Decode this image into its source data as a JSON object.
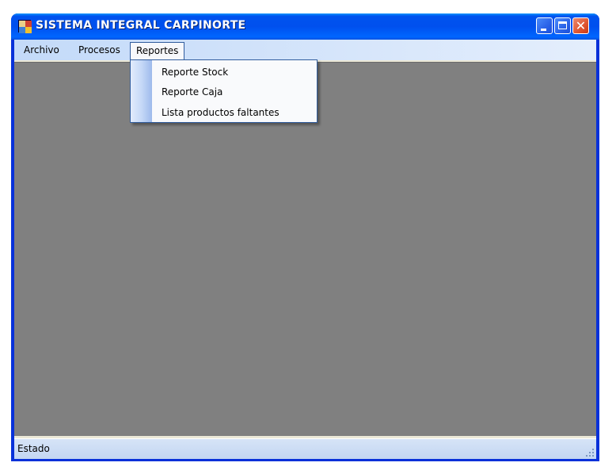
{
  "window": {
    "title": "SISTEMA INTEGRAL CARPINORTE",
    "close_glyph": "✕"
  },
  "menubar": {
    "items": [
      {
        "label": "Archivo"
      },
      {
        "label": "Procesos"
      },
      {
        "label": "Reportes",
        "open": true
      }
    ]
  },
  "dropdown": {
    "items": [
      {
        "label": "Reporte Stock"
      },
      {
        "label": "Reporte Caja"
      },
      {
        "label": "Lista productos faltantes"
      }
    ]
  },
  "statusbar": {
    "text": "Estado"
  },
  "icons": [
    "app-icon",
    "minimize-icon",
    "maximize-icon",
    "close-icon",
    "size-grip-icon"
  ],
  "colors": {
    "titlebar": "#0054e3",
    "menubar": "#c3daf9",
    "mdi_background": "#808080",
    "statusbar": "#c3d6f2"
  }
}
